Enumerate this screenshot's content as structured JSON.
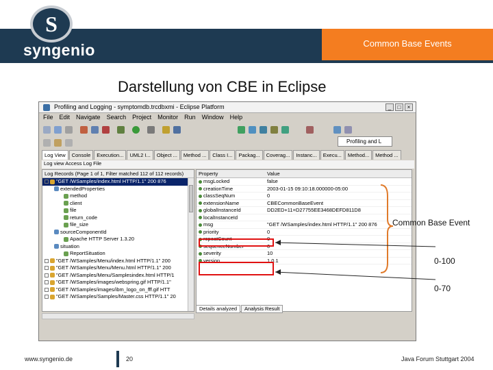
{
  "header": {
    "section_title": "Common Base Events",
    "logo_text": "syngenio",
    "logo_letter": "S"
  },
  "slide": {
    "title": "Darstellung von CBE in Eclipse"
  },
  "eclipse": {
    "window_title": "Profiling and Logging - symptomdb.trcdbxmi - Eclipse Platform",
    "menu": [
      "File",
      "Edit",
      "Navigate",
      "Search",
      "Project",
      "Monitor",
      "Run",
      "Window",
      "Help"
    ],
    "perspective_button": "Profiling and L",
    "tabs": [
      "Log View",
      "Console",
      "Execution...",
      "UML2 I...",
      "Object ...",
      "Method ...",
      "Class I...",
      "Packag...",
      "Coverag...",
      "Instanc...",
      "Execu...",
      "Method...",
      "Method ..."
    ],
    "sub_tab": "Log view   Access Log File",
    "log_header": "Log Records (Page 1 of 1, Filter matched 112 of 112 records)",
    "tree": [
      {
        "text": "\"GET /WSamples/index.html HTTP/1.1\" 200 876",
        "level": 0,
        "selected": true
      },
      {
        "text": "extendedProperties",
        "level": 1
      },
      {
        "text": "method",
        "level": 2
      },
      {
        "text": "client",
        "level": 2
      },
      {
        "text": "file",
        "level": 2
      },
      {
        "text": "return_code",
        "level": 2
      },
      {
        "text": "file_size",
        "level": 2
      },
      {
        "text": "sourceComponentId",
        "level": 1
      },
      {
        "text": "Apache HTTP Server 1.3.20",
        "level": 2
      },
      {
        "text": "situation",
        "level": 1
      },
      {
        "text": "ReportSituation",
        "level": 2
      },
      {
        "text": "\"GET /WSamples/Menu/index.html HTTP/1.1\" 200",
        "level": 0
      },
      {
        "text": "\"GET /WSamples/Menu/Menu.html HTTP/1.1\" 200",
        "level": 0
      },
      {
        "text": "\"GET /WSamples/Menu/Samplesindex.html HTTP/1",
        "level": 0
      },
      {
        "text": "\"GET /WSamples/images/webspring.gif HTTP/1.1\"",
        "level": 0
      },
      {
        "text": "\"GET /WSamples/images/ibm_logo_on_fff.gif HTT",
        "level": 0
      },
      {
        "text": "\"GET /WSamples/Samples/Master.css HTTP/1.1\" 20",
        "level": 0
      }
    ],
    "props_header": {
      "property": "Property",
      "value": "Value"
    },
    "properties": [
      {
        "name": "msgLocked",
        "value": "false"
      },
      {
        "name": "creationTime",
        "value": "2003-01-15 09:10:18.000000-05:00"
      },
      {
        "name": "classSeqNum",
        "value": "0"
      },
      {
        "name": "extensionName",
        "value": "CBECommonBaseEvent"
      },
      {
        "name": "globalInstanceId",
        "value": "DD2ED+11=D27755EE3468DEFD811D8"
      },
      {
        "name": "localInstanceId",
        "value": ""
      },
      {
        "name": "msg",
        "value": "\"GET /WSamples/index.html HTTP/1.1\" 200 876"
      },
      {
        "name": "priority",
        "value": "0"
      },
      {
        "name": "repeatCount",
        "value": "0"
      },
      {
        "name": "sequenceNumber",
        "value": "0"
      },
      {
        "name": "severity",
        "value": "10"
      },
      {
        "name": "version",
        "value": "1.0.1"
      }
    ],
    "bottom_tabs": [
      "Details analyzed",
      "Analysis Result"
    ]
  },
  "callouts": {
    "common_base_event": "Common Base Event",
    "priority_range": "0-100",
    "severity_range": "0-70"
  },
  "footer": {
    "website": "www.syngenio.de",
    "page_number": "20",
    "event": "Java Forum Stuttgart 2004"
  },
  "colors": {
    "navy": "#1e3a52",
    "orange": "#f47d20",
    "highlight_red": "#e01010",
    "brace_orange": "#e07a2a"
  }
}
